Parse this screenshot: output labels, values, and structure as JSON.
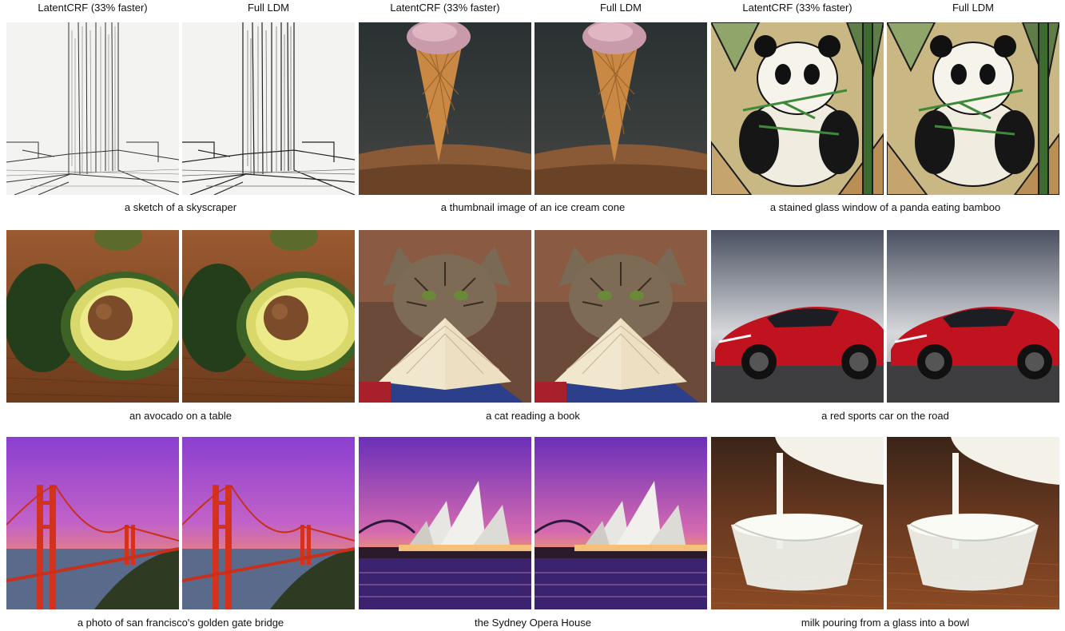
{
  "headers": [
    "LatentCRF (33% faster)",
    "Full LDM",
    "LatentCRF (33% faster)",
    "Full LDM",
    "LatentCRF (33% faster)",
    "Full LDM"
  ],
  "captions": [
    "a sketch of a skyscraper",
    "a thumbnail image of an ice cream cone",
    "a stained glass window of a panda eating bamboo",
    "an avocado on a table",
    "a cat reading a book",
    "a red sports car on the road",
    "a photo of san francisco's golden gate bridge",
    "the Sydney Opera House",
    "milk pouring from a glass into a bowl"
  ]
}
